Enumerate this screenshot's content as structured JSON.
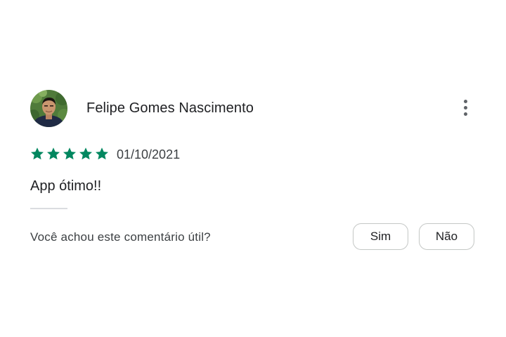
{
  "review": {
    "reviewer_name": "Felipe Gomes Nascimento",
    "rating": 5,
    "rating_max": 5,
    "date": "01/10/2021",
    "text": "App ótimo!!",
    "star_color": "#01875f"
  },
  "helpful": {
    "question": "Você achou este comentário útil?",
    "yes_label": "Sim",
    "no_label": "Não"
  }
}
